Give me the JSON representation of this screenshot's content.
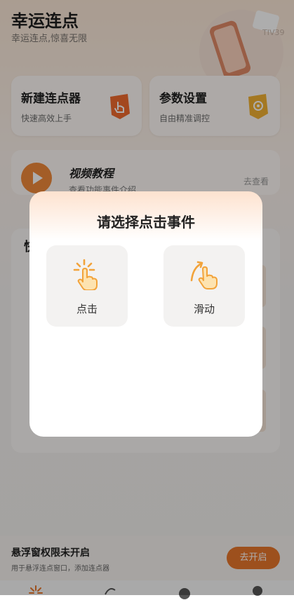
{
  "header": {
    "title": "幸运连点",
    "subtitle": "幸运连点,惊喜无限",
    "hero_badge": "TIV39"
  },
  "cards": [
    {
      "title": "新建连点器",
      "subtitle": "快速高效上手",
      "icon": "hand-icon",
      "accent": "#f06a2e"
    },
    {
      "title": "参数设置",
      "subtitle": "自由精准调控",
      "icon": "gear-icon",
      "accent": "#f2b233"
    }
  ],
  "video": {
    "title": "视频教程",
    "subtitle": "查看功能事件介绍",
    "action": "去查看"
  },
  "quick": {
    "title": "快"
  },
  "notice": {
    "title": "悬浮窗权限未开启",
    "subtitle": "用于悬浮连点窗口，添加连点器",
    "button": "去开启"
  },
  "dialog": {
    "title": "请选择点击事件",
    "options": [
      {
        "label": "点击",
        "icon": "tap-hand-icon"
      },
      {
        "label": "滑动",
        "icon": "swipe-hand-icon"
      }
    ]
  },
  "colors": {
    "accent": "#e8762b",
    "icon_orange": "#f2a33a"
  }
}
